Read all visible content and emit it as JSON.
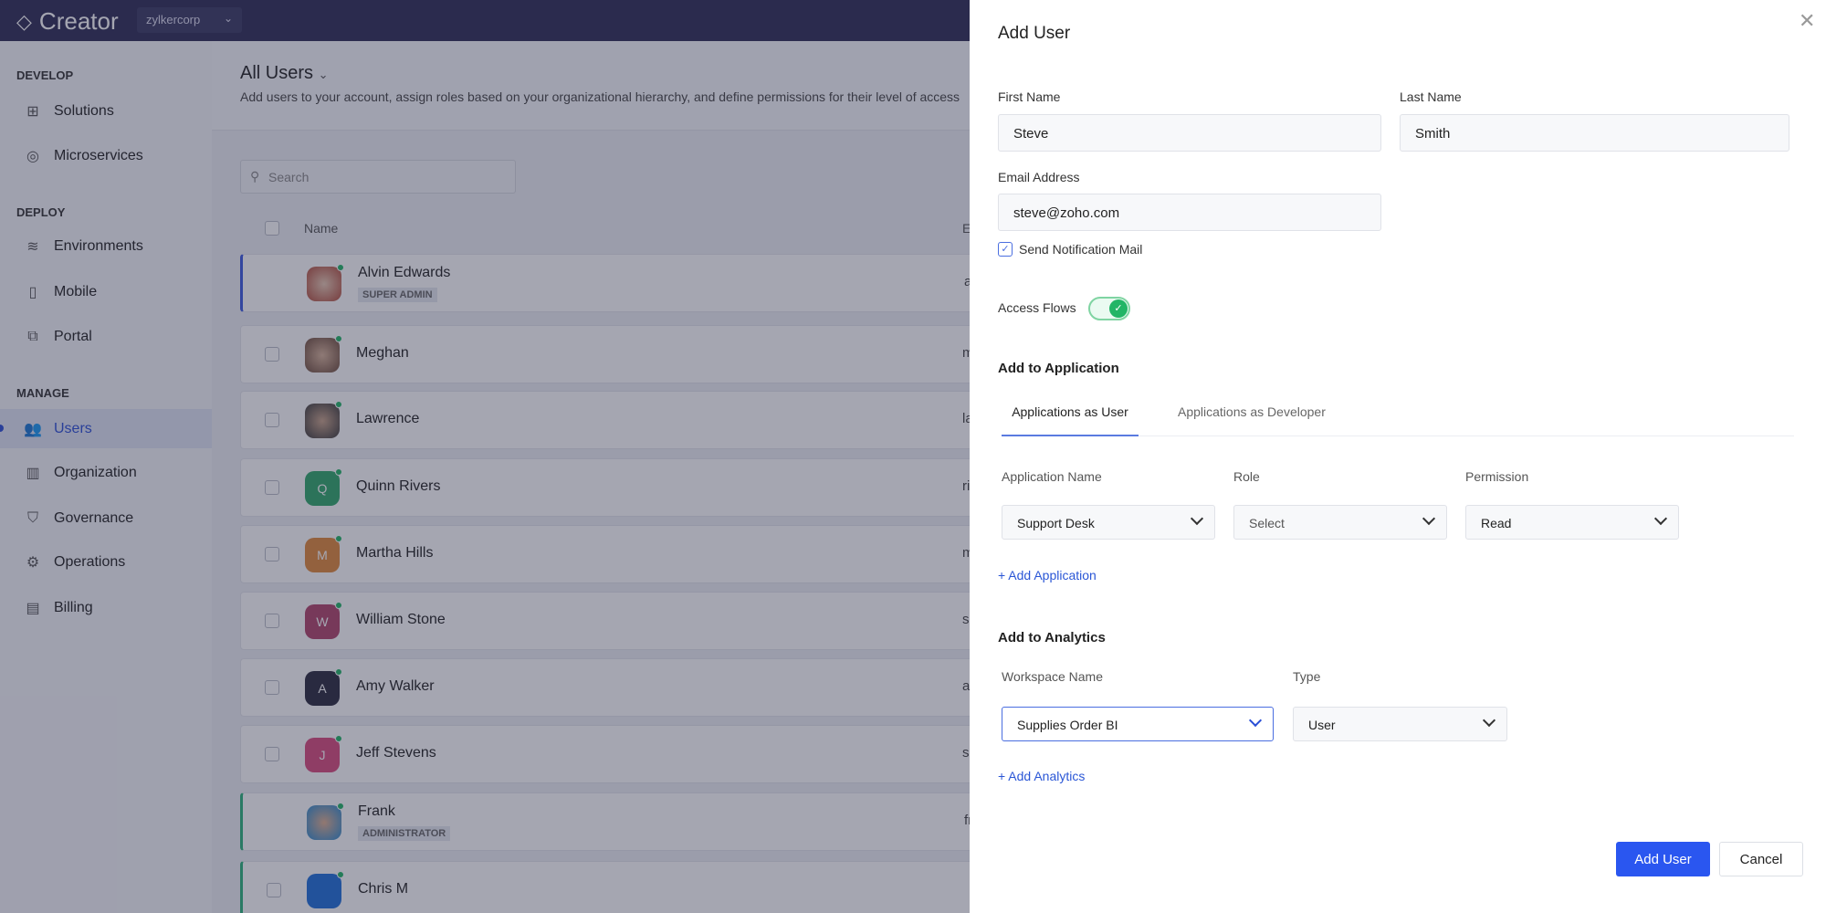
{
  "topbar": {
    "app_name": "Creator",
    "org": "zylkercorp"
  },
  "sidebar": {
    "sections": [
      {
        "label": "DEVELOP"
      },
      {
        "label": "DEPLOY"
      },
      {
        "label": "MANAGE"
      }
    ],
    "items": [
      {
        "label": "Solutions",
        "icon": "grid-icon"
      },
      {
        "label": "Microservices",
        "icon": "microservice-icon"
      },
      {
        "label": "Environments",
        "icon": "layers-icon"
      },
      {
        "label": "Mobile",
        "icon": "mobile-icon"
      },
      {
        "label": "Portal",
        "icon": "portal-icon"
      },
      {
        "label": "Users",
        "icon": "users-icon",
        "active": true
      },
      {
        "label": "Organization",
        "icon": "building-icon"
      },
      {
        "label": "Governance",
        "icon": "shield-icon"
      },
      {
        "label": "Operations",
        "icon": "gear-icon"
      },
      {
        "label": "Billing",
        "icon": "receipt-icon"
      }
    ]
  },
  "main": {
    "title": "All Users",
    "description": "Add users to your account, assign roles based on your organizational hierarchy, and define permissions for their level of access",
    "search_placeholder": "Search",
    "columns": {
      "name": "Name",
      "email": "E"
    },
    "users": [
      {
        "name": "Alvin Edwards",
        "badge": "SUPER ADMIN",
        "email_start": "a"
      },
      {
        "name": "Meghan",
        "email_start": "m"
      },
      {
        "name": "Lawrence",
        "email_start": "la"
      },
      {
        "name": "Quinn Rivers",
        "initial": "Q",
        "email_start": "ri"
      },
      {
        "name": "Martha Hills",
        "initial": "M",
        "email_start": "m"
      },
      {
        "name": "William Stone",
        "initial": "W",
        "email_start": "s"
      },
      {
        "name": "Amy Walker",
        "initial": "A",
        "email_start": "a"
      },
      {
        "name": "Jeff Stevens",
        "initial": "J",
        "email_start": "s"
      },
      {
        "name": "Frank",
        "badge": "ADMINISTRATOR",
        "email_start": "fr"
      },
      {
        "name": "Chris M"
      }
    ]
  },
  "panel": {
    "title": "Add User",
    "first_name_label": "First Name",
    "first_name": "Steve",
    "last_name_label": "Last Name",
    "last_name": "Smith",
    "email_label": "Email Address",
    "email": "steve@zoho.com",
    "send_notification": "Send Notification Mail",
    "access_flows": "Access Flows",
    "add_to_application": "Add to Application",
    "tabs": [
      "Applications as User",
      "Applications as Developer"
    ],
    "app_cols": [
      "Application Name",
      "Role",
      "Permission"
    ],
    "app_values": [
      "Support Desk",
      "Select",
      "Read"
    ],
    "add_application": "Add Application",
    "add_to_analytics": "Add to Analytics",
    "analytics_cols": [
      "Workspace Name",
      "Type"
    ],
    "analytics_values": [
      "Supplies Order BI",
      "User"
    ],
    "add_analytics": "Add Analytics",
    "submit": "Add User",
    "cancel": "Cancel"
  },
  "colors": {
    "accent": "#2a56f0",
    "success": "#22b566"
  }
}
